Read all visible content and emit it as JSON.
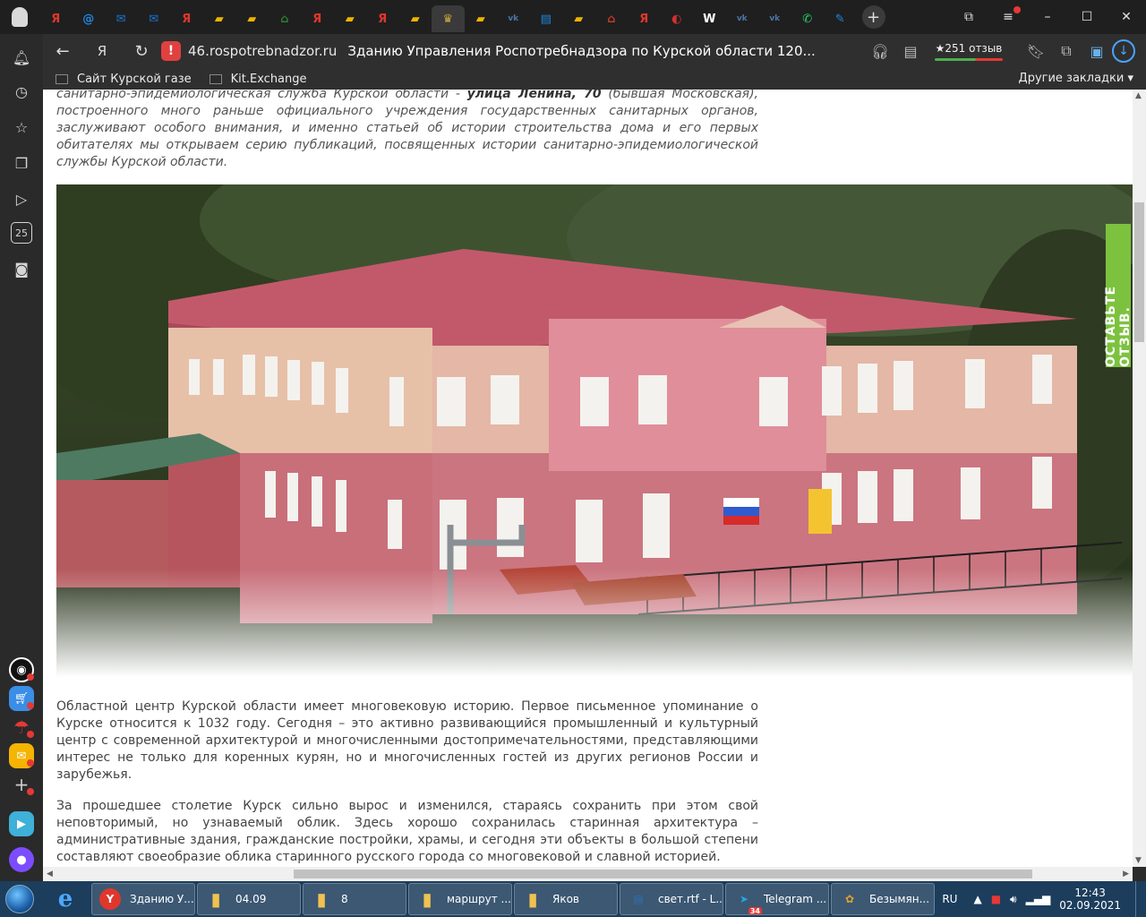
{
  "browser": {
    "tabs": [
      {
        "icon": "yandex-icon",
        "glyph": "Я",
        "color": "#e0372c"
      },
      {
        "icon": "mail-at-icon",
        "glyph": "@",
        "color": "#1e88e5"
      },
      {
        "icon": "mail-envelope-icon",
        "glyph": "✉",
        "color": "#1976d2"
      },
      {
        "icon": "mail-envelope-icon",
        "glyph": "✉",
        "color": "#1976d2"
      },
      {
        "icon": "yandex-icon",
        "glyph": "Я",
        "color": "#e0372c"
      },
      {
        "icon": "flag-icon",
        "glyph": "▰",
        "color": "#f0b400"
      },
      {
        "icon": "flag-icon",
        "glyph": "▰",
        "color": "#f0b400"
      },
      {
        "icon": "home-icon",
        "glyph": "⌂",
        "color": "#2e7d32"
      },
      {
        "icon": "yandex-icon",
        "glyph": "Я",
        "color": "#e0372c"
      },
      {
        "icon": "flag-icon",
        "glyph": "▰",
        "color": "#f0b400"
      },
      {
        "icon": "yandex-icon",
        "glyph": "Я",
        "color": "#e0372c"
      },
      {
        "icon": "flag-icon",
        "glyph": "▰",
        "color": "#f0b400"
      },
      {
        "icon": "emblem-icon",
        "glyph": "♛",
        "color": "#cfa640"
      },
      {
        "icon": "flag-icon",
        "glyph": "▰",
        "color": "#f0b400"
      },
      {
        "icon": "vk-icon",
        "glyph": "vk",
        "color": "#4a76a8"
      },
      {
        "icon": "chat-icon",
        "glyph": "▤",
        "color": "#1e88e5"
      },
      {
        "icon": "flag-icon",
        "glyph": "▰",
        "color": "#f0b400"
      },
      {
        "icon": "house-icon",
        "glyph": "⌂",
        "color": "#c0392b"
      },
      {
        "icon": "yandex-icon",
        "glyph": "Я",
        "color": "#e0372c"
      },
      {
        "icon": "opera-icon",
        "glyph": "◐",
        "color": "#d32f2f"
      },
      {
        "icon": "wikipedia-icon",
        "glyph": "W",
        "color": "#ffffff"
      },
      {
        "icon": "vk-icon",
        "glyph": "vk",
        "color": "#4a76a8"
      },
      {
        "icon": "vk-icon",
        "glyph": "vk",
        "color": "#4a76a8"
      },
      {
        "icon": "whatsapp-icon",
        "glyph": "✆",
        "color": "#25d366"
      },
      {
        "icon": "feather-icon",
        "glyph": "✎",
        "color": "#1e88e5"
      }
    ],
    "active_tab_index": 12,
    "domain": "46.rospotrebnadzor.ru",
    "page_title": "Зданию Управления Роспотребнадзора по Курской области 120...",
    "reviews": "★251 отзыв",
    "bookmarks": [
      "Сайт Курской газе",
      "Kit.Exchange"
    ],
    "other_bookmarks": "Другие закладки ▾"
  },
  "page": {
    "intro_prefix": "санитарно-эпидемиологическая служба Курской области - ",
    "intro_bold": "улица Ленина, 70",
    "intro_rest": " (бывшая Московская), построенного много раньше официального учреждения государственных санитарных органов, заслуживают особого внимания, и именно статьей об истории строительства дома и его первых обитателях мы открываем серию публикаций, посвященных истории санитарно-эпидемиологической службы Курской области.",
    "para1": "Областной центр Курской области имеет многовековую историю. Первое письменное упоминание о Курске относится к 1032 году. Сегодня – это активно развивающийся промышленный и культурный центр с современной архитектурой и многочисленными достопримечательностями, представляющими интерес не только для коренных курян, но и многочисленных гостей из других регионов России и зарубежья.",
    "para2": "За прошедшее столетие Курск сильно вырос и изменился, стараясь сохранить при этом свой неповторимый, но узнаваемый облик. Здесь хорошо сохранилась старинная архитектура – административные здания, гражданские постройки, храмы, и сегодня эти объекты в большой степени составляют своеобразие облика старинного русского города со многовековой и славной историей.",
    "feedback": "ОСТАВЬТЕ ОТЗЫВ."
  },
  "sidebar": {
    "calendar_day": "25"
  },
  "taskbar": {
    "tasks": [
      {
        "label": "Зданию У...",
        "icon": "yandex-browser-icon",
        "glyph": "Y",
        "color": "#ffffff"
      },
      {
        "label": "04.09",
        "icon": "folder-icon",
        "glyph": "▮",
        "color": "#f2c14e"
      },
      {
        "label": "8",
        "icon": "folder-icon",
        "glyph": "▮",
        "color": "#f2c14e"
      },
      {
        "label": "маршрут ...",
        "icon": "folder-icon",
        "glyph": "▮",
        "color": "#f2c14e"
      },
      {
        "label": "Яков",
        "icon": "folder-icon",
        "glyph": "▮",
        "color": "#f2c14e"
      },
      {
        "label": "свет.rtf - L...",
        "icon": "writer-icon",
        "glyph": "▤",
        "color": "#2f6fb7"
      },
      {
        "label": "Telegram ...",
        "icon": "telegram-icon",
        "glyph": "➤",
        "color": "#2aa3df"
      },
      {
        "label": "Безымян...",
        "icon": "paint-icon",
        "glyph": "✿",
        "color": "#e0a030"
      }
    ],
    "telegram_count": "34",
    "lang": "RU",
    "time": "12:43",
    "date": "02.09.2021"
  }
}
